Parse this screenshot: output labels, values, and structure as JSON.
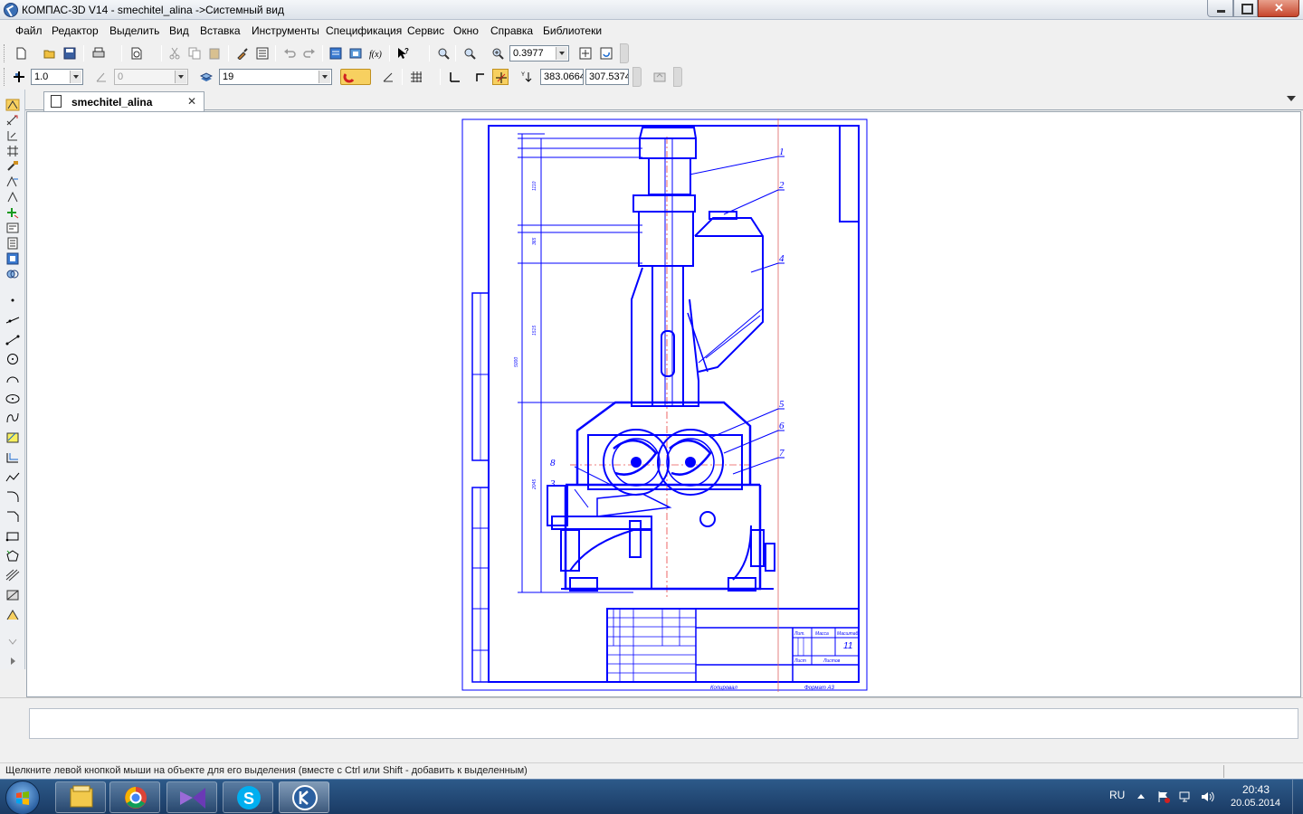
{
  "window": {
    "title": "КОМПАС-3D V14 - smechitel_alina ->Системный вид"
  },
  "menu": {
    "items": [
      "Файл",
      "Редактор",
      "Выделить",
      "Вид",
      "Вставка",
      "Инструменты",
      "Спецификация",
      "Сервис",
      "Окно",
      "Справка",
      "Библиотеки"
    ]
  },
  "toolbar": {
    "zoom_value": "0.3977",
    "step_value": "1.0",
    "angle_value": "0",
    "layer_value": "19",
    "coord_x": "383.0664",
    "coord_y": "307.5374"
  },
  "document": {
    "tab_label": "smechitel_alina"
  },
  "drawing": {
    "callouts": [
      "1",
      "2",
      "4",
      "5",
      "6",
      "7",
      "8",
      "3"
    ],
    "sheet_number": "11",
    "copied_label": "Копировал",
    "format_label": "Формат   А3",
    "stamp_labels": [
      "Лит.",
      "Масса",
      "Масштаб",
      "Лист",
      "Листов"
    ]
  },
  "status": {
    "hint": "Щелкните левой кнопкой мыши на объекте для его выделения (вместе с Ctrl или Shift - добавить к выделенным)"
  },
  "taskbar": {
    "language": "RU",
    "time": "20:43",
    "date": "20.05.2014",
    "apps": [
      "file-explorer-icon",
      "chrome-icon",
      "visual-studio-icon",
      "skype-icon",
      "kompas-icon"
    ]
  },
  "colors": {
    "drawing_blue": "#0000ff",
    "axis_red": "#e00000",
    "taskbar": "#1f4570"
  }
}
